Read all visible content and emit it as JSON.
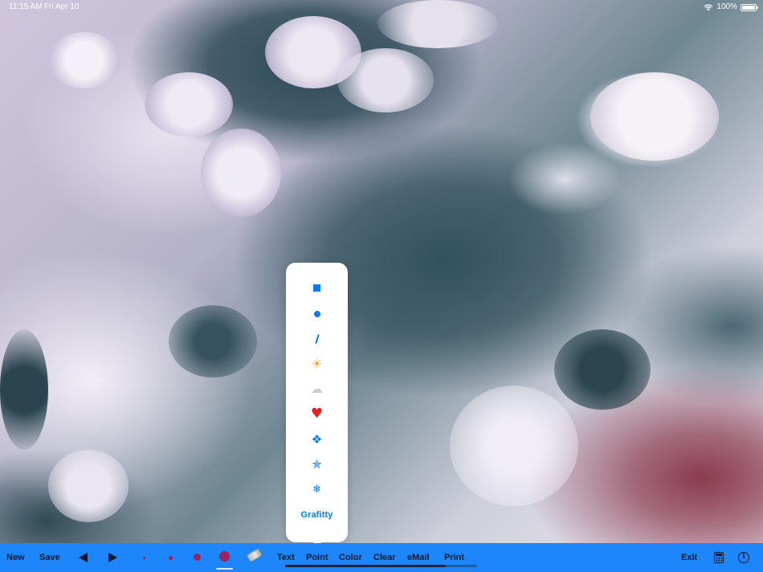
{
  "status_bar": {
    "time": "11:15 AM",
    "date": "Fri Apr 10",
    "battery": "100%",
    "icons": [
      "wifi-icon",
      "battery-icon"
    ]
  },
  "popover": {
    "items": [
      {
        "name": "square-shape",
        "icon": "square-icon",
        "color": "#0a7af5"
      },
      {
        "name": "circle-shape",
        "icon": "circle-icon",
        "color": "#0a7af5"
      },
      {
        "name": "line-shape",
        "icon": "line-icon",
        "color": "#0a7af5"
      },
      {
        "name": "sun-stamp",
        "icon": "sun-icon",
        "glyph": "☀"
      },
      {
        "name": "cloud-stamp",
        "icon": "cloud-icon",
        "glyph": "☁"
      },
      {
        "name": "heart-stamp",
        "icon": "heart-icon",
        "glyph": "♥"
      },
      {
        "name": "diamond-stamp",
        "icon": "diamonds-icon",
        "glyph": "❖"
      },
      {
        "name": "star-stamp",
        "icon": "star-icon",
        "glyph": "✯"
      },
      {
        "name": "snowflake-stamp",
        "icon": "snowflake-icon",
        "glyph": "❄"
      }
    ],
    "grafitty_label": "Grafitty"
  },
  "toolbar": {
    "new_label": "New",
    "save_label": "Save",
    "undo_icon": "triangle-left-icon",
    "redo_icon": "triangle-right-icon",
    "brush_sizes": [
      "tiny",
      "small",
      "medium",
      "large"
    ],
    "selected_brush": "large",
    "brush_color": "#9c2263",
    "eraser_icon": "eraser-icon",
    "text_label": "Text",
    "point_label": "Point",
    "color_label": "Color",
    "clear_label": "Clear",
    "email_label": "eMail",
    "print_label": "Print",
    "exit_label": "Exit",
    "calculator_icon": "calculator-icon",
    "info_icon": "info-icon",
    "accent_color": "#1d86fb"
  }
}
